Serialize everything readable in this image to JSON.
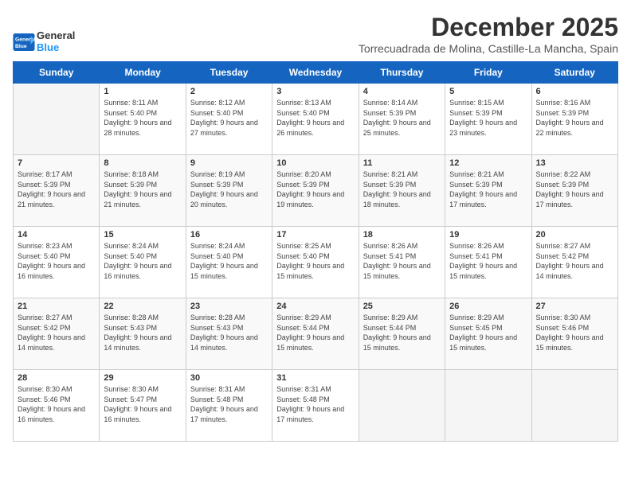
{
  "logo": {
    "line1": "General",
    "line2": "Blue"
  },
  "title": "December 2025",
  "location": "Torrecuadrada de Molina, Castille-La Mancha, Spain",
  "days_of_week": [
    "Sunday",
    "Monday",
    "Tuesday",
    "Wednesday",
    "Thursday",
    "Friday",
    "Saturday"
  ],
  "weeks": [
    [
      {
        "day": "",
        "sunrise": "",
        "sunset": "",
        "daylight": ""
      },
      {
        "day": "1",
        "sunrise": "Sunrise: 8:11 AM",
        "sunset": "Sunset: 5:40 PM",
        "daylight": "Daylight: 9 hours and 28 minutes."
      },
      {
        "day": "2",
        "sunrise": "Sunrise: 8:12 AM",
        "sunset": "Sunset: 5:40 PM",
        "daylight": "Daylight: 9 hours and 27 minutes."
      },
      {
        "day": "3",
        "sunrise": "Sunrise: 8:13 AM",
        "sunset": "Sunset: 5:40 PM",
        "daylight": "Daylight: 9 hours and 26 minutes."
      },
      {
        "day": "4",
        "sunrise": "Sunrise: 8:14 AM",
        "sunset": "Sunset: 5:39 PM",
        "daylight": "Daylight: 9 hours and 25 minutes."
      },
      {
        "day": "5",
        "sunrise": "Sunrise: 8:15 AM",
        "sunset": "Sunset: 5:39 PM",
        "daylight": "Daylight: 9 hours and 23 minutes."
      },
      {
        "day": "6",
        "sunrise": "Sunrise: 8:16 AM",
        "sunset": "Sunset: 5:39 PM",
        "daylight": "Daylight: 9 hours and 22 minutes."
      }
    ],
    [
      {
        "day": "7",
        "sunrise": "Sunrise: 8:17 AM",
        "sunset": "Sunset: 5:39 PM",
        "daylight": "Daylight: 9 hours and 21 minutes."
      },
      {
        "day": "8",
        "sunrise": "Sunrise: 8:18 AM",
        "sunset": "Sunset: 5:39 PM",
        "daylight": "Daylight: 9 hours and 21 minutes."
      },
      {
        "day": "9",
        "sunrise": "Sunrise: 8:19 AM",
        "sunset": "Sunset: 5:39 PM",
        "daylight": "Daylight: 9 hours and 20 minutes."
      },
      {
        "day": "10",
        "sunrise": "Sunrise: 8:20 AM",
        "sunset": "Sunset: 5:39 PM",
        "daylight": "Daylight: 9 hours and 19 minutes."
      },
      {
        "day": "11",
        "sunrise": "Sunrise: 8:21 AM",
        "sunset": "Sunset: 5:39 PM",
        "daylight": "Daylight: 9 hours and 18 minutes."
      },
      {
        "day": "12",
        "sunrise": "Sunrise: 8:21 AM",
        "sunset": "Sunset: 5:39 PM",
        "daylight": "Daylight: 9 hours and 17 minutes."
      },
      {
        "day": "13",
        "sunrise": "Sunrise: 8:22 AM",
        "sunset": "Sunset: 5:39 PM",
        "daylight": "Daylight: 9 hours and 17 minutes."
      }
    ],
    [
      {
        "day": "14",
        "sunrise": "Sunrise: 8:23 AM",
        "sunset": "Sunset: 5:40 PM",
        "daylight": "Daylight: 9 hours and 16 minutes."
      },
      {
        "day": "15",
        "sunrise": "Sunrise: 8:24 AM",
        "sunset": "Sunset: 5:40 PM",
        "daylight": "Daylight: 9 hours and 16 minutes."
      },
      {
        "day": "16",
        "sunrise": "Sunrise: 8:24 AM",
        "sunset": "Sunset: 5:40 PM",
        "daylight": "Daylight: 9 hours and 15 minutes."
      },
      {
        "day": "17",
        "sunrise": "Sunrise: 8:25 AM",
        "sunset": "Sunset: 5:40 PM",
        "daylight": "Daylight: 9 hours and 15 minutes."
      },
      {
        "day": "18",
        "sunrise": "Sunrise: 8:26 AM",
        "sunset": "Sunset: 5:41 PM",
        "daylight": "Daylight: 9 hours and 15 minutes."
      },
      {
        "day": "19",
        "sunrise": "Sunrise: 8:26 AM",
        "sunset": "Sunset: 5:41 PM",
        "daylight": "Daylight: 9 hours and 15 minutes."
      },
      {
        "day": "20",
        "sunrise": "Sunrise: 8:27 AM",
        "sunset": "Sunset: 5:42 PM",
        "daylight": "Daylight: 9 hours and 14 minutes."
      }
    ],
    [
      {
        "day": "21",
        "sunrise": "Sunrise: 8:27 AM",
        "sunset": "Sunset: 5:42 PM",
        "daylight": "Daylight: 9 hours and 14 minutes."
      },
      {
        "day": "22",
        "sunrise": "Sunrise: 8:28 AM",
        "sunset": "Sunset: 5:43 PM",
        "daylight": "Daylight: 9 hours and 14 minutes."
      },
      {
        "day": "23",
        "sunrise": "Sunrise: 8:28 AM",
        "sunset": "Sunset: 5:43 PM",
        "daylight": "Daylight: 9 hours and 14 minutes."
      },
      {
        "day": "24",
        "sunrise": "Sunrise: 8:29 AM",
        "sunset": "Sunset: 5:44 PM",
        "daylight": "Daylight: 9 hours and 15 minutes."
      },
      {
        "day": "25",
        "sunrise": "Sunrise: 8:29 AM",
        "sunset": "Sunset: 5:44 PM",
        "daylight": "Daylight: 9 hours and 15 minutes."
      },
      {
        "day": "26",
        "sunrise": "Sunrise: 8:29 AM",
        "sunset": "Sunset: 5:45 PM",
        "daylight": "Daylight: 9 hours and 15 minutes."
      },
      {
        "day": "27",
        "sunrise": "Sunrise: 8:30 AM",
        "sunset": "Sunset: 5:46 PM",
        "daylight": "Daylight: 9 hours and 15 minutes."
      }
    ],
    [
      {
        "day": "28",
        "sunrise": "Sunrise: 8:30 AM",
        "sunset": "Sunset: 5:46 PM",
        "daylight": "Daylight: 9 hours and 16 minutes."
      },
      {
        "day": "29",
        "sunrise": "Sunrise: 8:30 AM",
        "sunset": "Sunset: 5:47 PM",
        "daylight": "Daylight: 9 hours and 16 minutes."
      },
      {
        "day": "30",
        "sunrise": "Sunrise: 8:31 AM",
        "sunset": "Sunset: 5:48 PM",
        "daylight": "Daylight: 9 hours and 17 minutes."
      },
      {
        "day": "31",
        "sunrise": "Sunrise: 8:31 AM",
        "sunset": "Sunset: 5:48 PM",
        "daylight": "Daylight: 9 hours and 17 minutes."
      },
      {
        "day": "",
        "sunrise": "",
        "sunset": "",
        "daylight": ""
      },
      {
        "day": "",
        "sunrise": "",
        "sunset": "",
        "daylight": ""
      },
      {
        "day": "",
        "sunrise": "",
        "sunset": "",
        "daylight": ""
      }
    ]
  ]
}
